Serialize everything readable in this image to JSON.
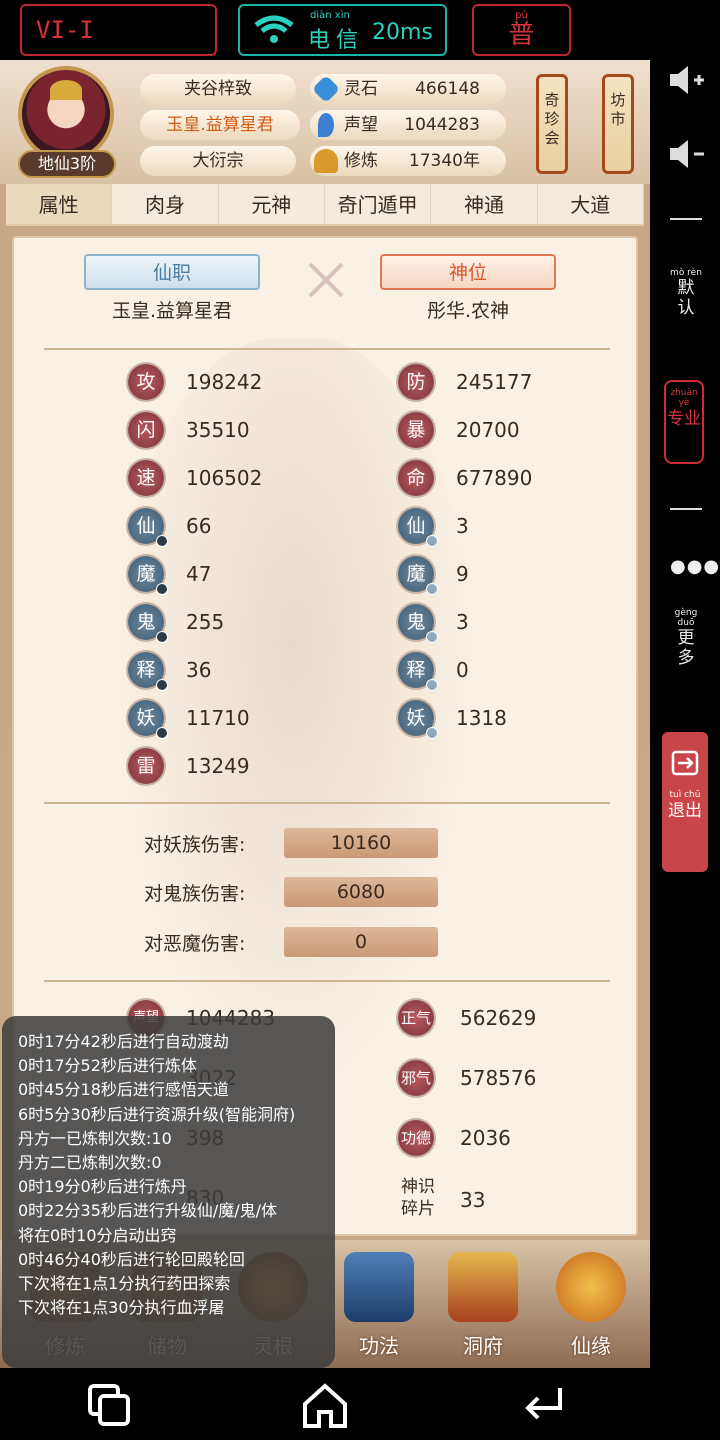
{
  "status_bar": {
    "left_box": "VI-I",
    "carrier_pinyin": "diàn xìn",
    "carrier": "电信",
    "ping": "20ms",
    "right_pinyin": "pǔ",
    "right_char": "普"
  },
  "profile": {
    "realm": "地仙3阶",
    "name_tags": [
      "夹谷梓致",
      "玉皇.益算星君",
      "大衍宗"
    ],
    "resources": [
      {
        "label": "灵石",
        "value": "466148",
        "icon": "spirit-stone-icon",
        "color": "#3a8fd8"
      },
      {
        "label": "声望",
        "value": "1044283",
        "icon": "fame-icon",
        "color": "#3a7fd0"
      },
      {
        "label": "修炼",
        "value": "17340年",
        "icon": "meditation-icon",
        "color": "#d89a2a"
      }
    ],
    "hanging_buttons": [
      {
        "label": "奇珍会"
      },
      {
        "label": "坊市"
      }
    ]
  },
  "tabs": [
    "属性",
    "肉身",
    "元神",
    "奇门遁甲",
    "神通",
    "大道"
  ],
  "active_tab": "属性",
  "titles": {
    "xianzhi_label": "仙职",
    "xianzhi_value": "玉皇.益算星君",
    "shenwei_label": "神位",
    "shenwei_value": "彤华.农神"
  },
  "stats_left": [
    {
      "glyph": "攻",
      "value": "198242"
    },
    {
      "glyph": "闪",
      "value": "35510"
    },
    {
      "glyph": "速",
      "value": "106502"
    },
    {
      "glyph": "仙",
      "value": "66"
    },
    {
      "glyph": "魔",
      "value": "47"
    },
    {
      "glyph": "鬼",
      "value": "255"
    },
    {
      "glyph": "释",
      "value": "36"
    },
    {
      "glyph": "妖",
      "value": "11710"
    },
    {
      "glyph": "雷",
      "value": "13249"
    }
  ],
  "stats_right": [
    {
      "glyph": "防",
      "value": "245177"
    },
    {
      "glyph": "暴",
      "value": "20700"
    },
    {
      "glyph": "命",
      "value": "677890"
    },
    {
      "glyph": "仙",
      "value": "3"
    },
    {
      "glyph": "魔",
      "value": "9"
    },
    {
      "glyph": "鬼",
      "value": "3"
    },
    {
      "glyph": "释",
      "value": "0"
    },
    {
      "glyph": "妖",
      "value": "1318"
    }
  ],
  "damage": [
    {
      "label": "对妖族伤害:",
      "value": "10160"
    },
    {
      "label": "对鬼族伤害:",
      "value": "6080"
    },
    {
      "label": "对恶魔伤害:",
      "value": "0"
    }
  ],
  "lower_stats": {
    "fame_label": "声望",
    "fame_value": "1044283",
    "partial_values": [
      "3022",
      "398",
      "830"
    ],
    "right": [
      {
        "label": "正气",
        "value": "562629"
      },
      {
        "label": "邪气",
        "value": "578576"
      },
      {
        "label": "功德",
        "value": "2036"
      },
      {
        "label": "神识碎片",
        "value": "33"
      }
    ]
  },
  "log_lines": [
    "0时17分42秒后进行自动渡劫",
    "0时17分52秒后进行炼体",
    "0时45分18秒后进行感悟天道",
    "6时5分30秒后进行资源升级(智能洞府)",
    "丹方一已炼制次数:10",
    "丹方二已炼制次数:0",
    "0时19分0秒后进行炼丹",
    "0时22分35秒后进行升级仙/魔/鬼/体",
    "将在0时10分启动出窍",
    "0时46分40秒后进行轮回殿轮回",
    "下次将在1点1分执行药田探索",
    "下次将在1点30分执行血浮屠"
  ],
  "bottom_nav": [
    "修炼",
    "储物",
    "灵根",
    "功法",
    "洞府",
    "仙缘"
  ],
  "right_panel": {
    "moren_pinyin": "mò rèn",
    "moren": "默认",
    "zhuanye_pinyin": "zhuān yè",
    "zhuanye": "专业",
    "gengduo_pinyin": "gèng duō",
    "gengduo": "更多",
    "tuichu_pinyin": "tuì chū",
    "tuichu": "退出"
  }
}
